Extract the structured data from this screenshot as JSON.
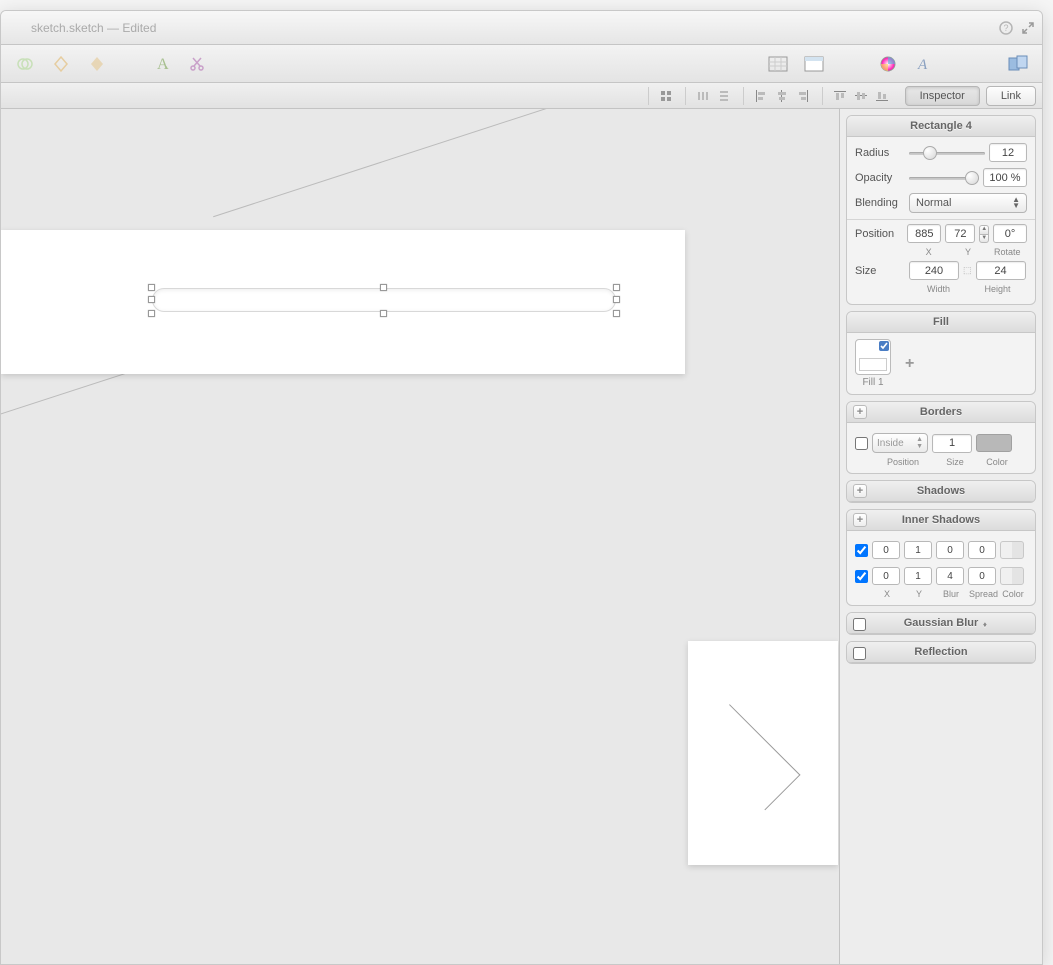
{
  "window": {
    "title": "sketch.sketch — Edited"
  },
  "subtoolbar": {
    "inspector_tab": "Inspector",
    "link_tab": "Link"
  },
  "inspector": {
    "selection_name": "Rectangle 4",
    "radius": {
      "label": "Radius",
      "value": "12"
    },
    "opacity": {
      "label": "Opacity",
      "value": "100 %"
    },
    "blending": {
      "label": "Blending",
      "value": "Normal"
    },
    "position": {
      "label": "Position",
      "x": "885",
      "y": "72",
      "rotate": "0°",
      "x_label": "X",
      "y_label": "Y",
      "rotate_label": "Rotate"
    },
    "size": {
      "label": "Size",
      "width": "240",
      "height": "24",
      "width_label": "Width",
      "height_label": "Height"
    },
    "fill": {
      "header": "Fill",
      "item_label": "Fill 1"
    },
    "borders": {
      "header": "Borders",
      "position_value": "Inside",
      "size_value": "1",
      "position_label": "Position",
      "size_label": "Size",
      "color_label": "Color"
    },
    "shadows": {
      "header": "Shadows"
    },
    "inner_shadows": {
      "header": "Inner Shadows",
      "rows": [
        {
          "x": "0",
          "y": "1",
          "blur": "0",
          "spread": "0"
        },
        {
          "x": "0",
          "y": "1",
          "blur": "4",
          "spread": "0"
        }
      ],
      "x_label": "X",
      "y_label": "Y",
      "blur_label": "Blur",
      "spread_label": "Spread",
      "color_label": "Color"
    },
    "gaussian_blur": {
      "header": "Gaussian Blur"
    },
    "reflection": {
      "header": "Reflection"
    }
  }
}
